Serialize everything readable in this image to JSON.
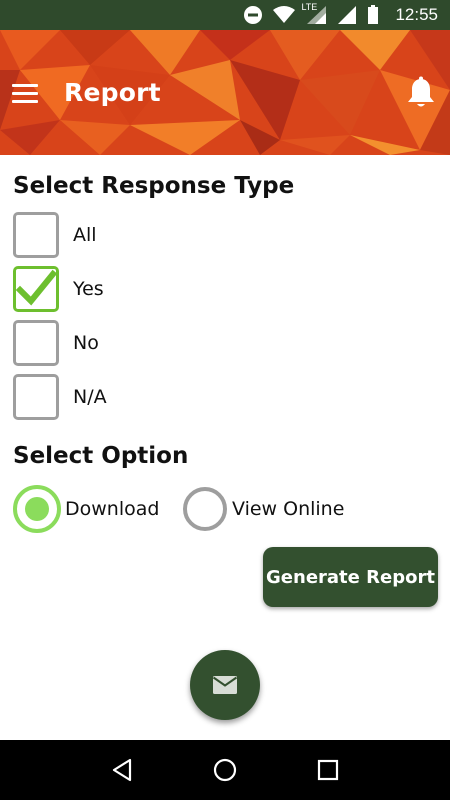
{
  "status_bar": {
    "time": "12:55",
    "icons": [
      "do-not-disturb-icon",
      "wifi-icon",
      "lte-signal-icon",
      "signal-icon",
      "battery-icon"
    ],
    "lte_label": "LTE"
  },
  "app_bar": {
    "title": "Report",
    "menu_icon": "hamburger-menu-icon",
    "notification_icon": "bell-icon",
    "background_color": "#d8441a"
  },
  "response_type": {
    "title": "Select Response Type",
    "options": [
      {
        "label": "All",
        "checked": false
      },
      {
        "label": "Yes",
        "checked": true
      },
      {
        "label": "No",
        "checked": false
      },
      {
        "label": "N/A",
        "checked": false
      }
    ]
  },
  "option": {
    "title": "Select Option",
    "choices": [
      {
        "label": "Download",
        "selected": true
      },
      {
        "label": "View Online",
        "selected": false
      }
    ]
  },
  "actions": {
    "generate_label": "Generate Report",
    "fab_icon": "email-icon"
  },
  "colors": {
    "primary_dark": "#33502f",
    "accent_green": "#6dbf2e",
    "radio_green": "#8bdc5c",
    "status_bar": "#2f4a2c"
  },
  "nav_bar": {
    "buttons": [
      "back-icon",
      "home-icon",
      "recents-icon"
    ]
  }
}
